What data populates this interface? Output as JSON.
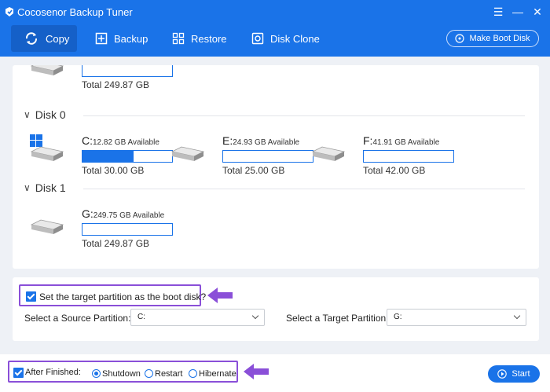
{
  "app": {
    "title": "Cocosenor Backup Tuner"
  },
  "toolbar": {
    "copy": "Copy",
    "backup": "Backup",
    "restore": "Restore",
    "disk_clone": "Disk Clone",
    "make_boot_disk": "Make Boot Disk"
  },
  "disks": {
    "top_partition": {
      "total": "Total 249.87 GB"
    },
    "disk0": {
      "label": "Disk 0",
      "partitions": [
        {
          "letter": "C:",
          "available": "12.82 GB Available",
          "total": "Total 30.00 GB",
          "used_fraction": 0.57,
          "icon": "windows-icon"
        },
        {
          "letter": "E:",
          "available": "24.93 GB Available",
          "total": "Total 25.00 GB",
          "used_fraction": 0.0
        },
        {
          "letter": "F:",
          "available": "41.91 GB Available",
          "total": "Total 42.00 GB",
          "used_fraction": 0.0
        }
      ]
    },
    "disk1": {
      "label": "Disk 1",
      "partitions": [
        {
          "letter": "G:",
          "available": "249.75 GB Available",
          "total": "Total 249.87 GB",
          "used_fraction": 0.0
        }
      ]
    }
  },
  "options": {
    "boot_checkbox_label": "Set the target partition as the boot disk?",
    "source_label": "Select a Source Partition:",
    "source_value": "C:",
    "target_label": "Select a Target Partition:",
    "target_value": "G:"
  },
  "footer": {
    "after_finished_label": "After Finished:",
    "radios": [
      "Shutdown",
      "Restart",
      "Hibernate"
    ],
    "selected": "Shutdown",
    "start": "Start"
  },
  "colors": {
    "accent": "#1a73e8",
    "highlight": "#8a4fd8",
    "panel_bg": "#eef1f6"
  }
}
